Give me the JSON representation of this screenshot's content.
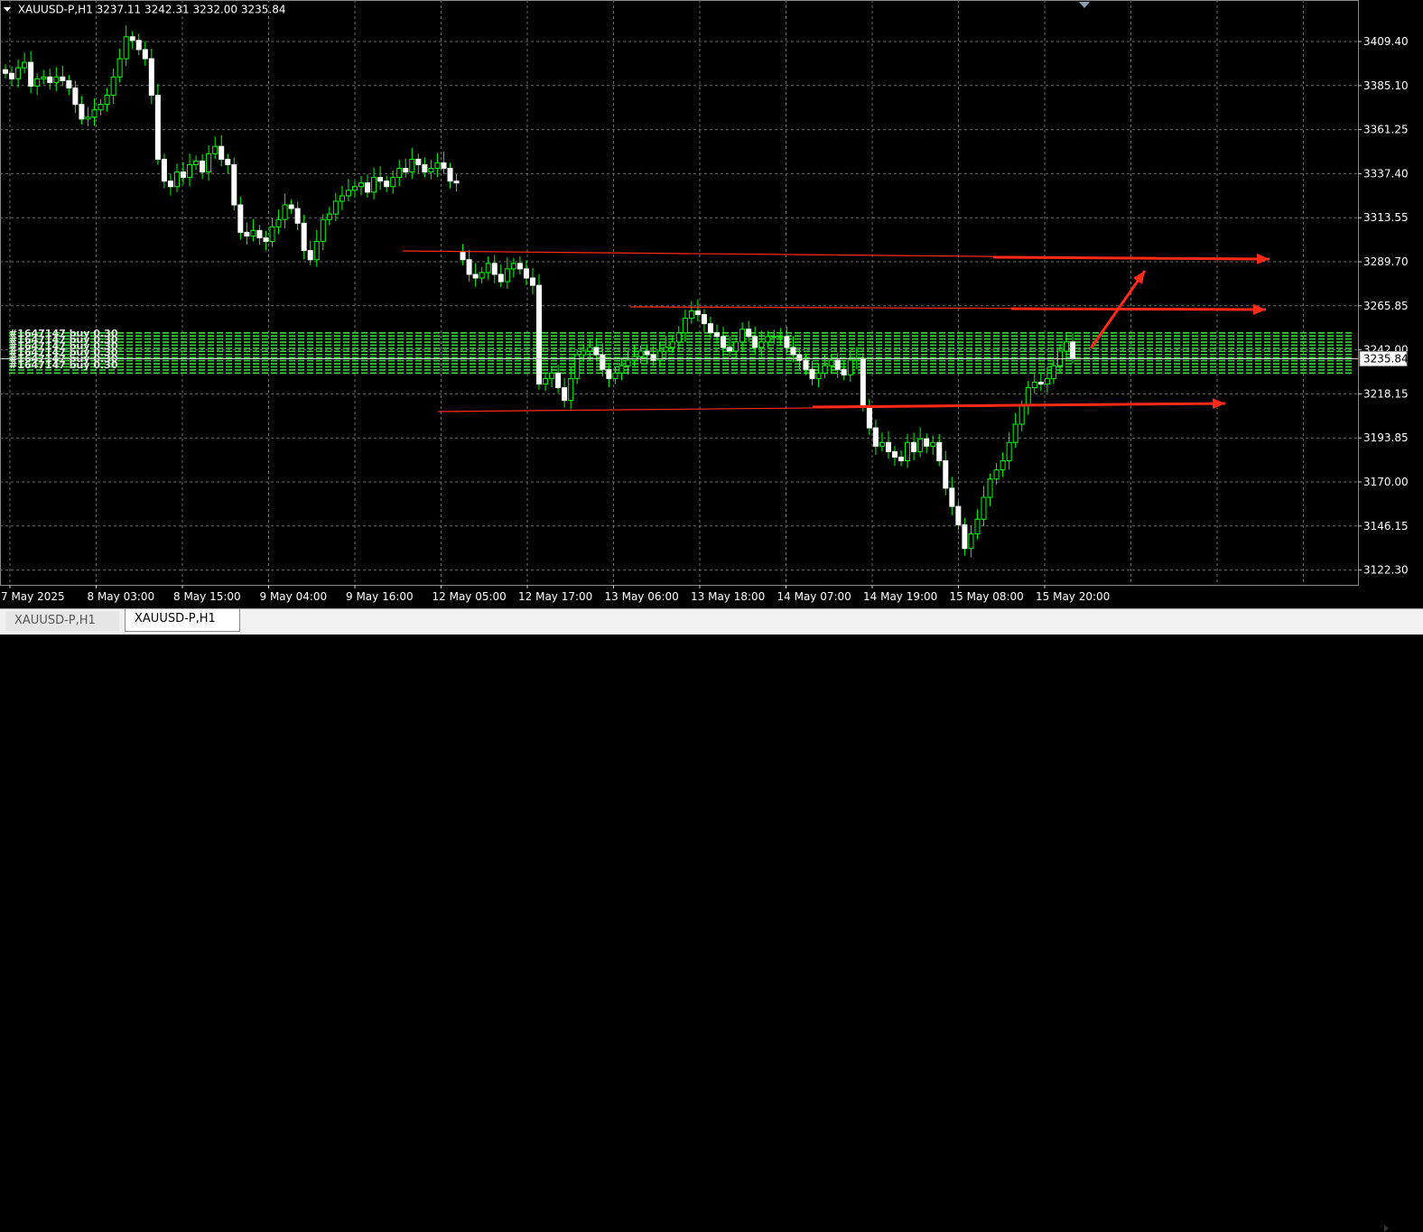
{
  "header": {
    "symbol": "XAUUSD-P,H1",
    "ohlc": "3237.11 3242.31 3232.00 3235.84"
  },
  "chart_data": {
    "type": "candlestick",
    "price_ticks": [
      "3409.40",
      "3385.10",
      "3361.25",
      "3337.40",
      "3313.55",
      "3289.70",
      "3265.85",
      "3242.00",
      "3218.15",
      "3193.85",
      "3170.00",
      "3146.15",
      "3122.30"
    ],
    "current_price": "3235.84",
    "time_ticks": [
      "7 May 2025",
      "8 May 03:00",
      "8 May 15:00",
      "9 May 04:00",
      "9 May 16:00",
      "12 May 05:00",
      "12 May 17:00",
      "13 May 06:00",
      "13 May 18:00",
      "14 May 07:00",
      "14 May 19:00",
      "15 May 08:00",
      "15 May 20:00"
    ],
    "candles": [
      3392,
      3389,
      3395,
      3398,
      3385,
      3389,
      3390,
      3387,
      3390,
      3388,
      3384,
      3375,
      3367,
      3368,
      3372,
      3375,
      3380,
      3390,
      3400,
      3412,
      3410,
      3405,
      3400,
      3380,
      3345,
      3333,
      3330,
      3338,
      3335,
      3342,
      3344,
      3338,
      3348,
      3352,
      3345,
      3342,
      3320,
      3305,
      3303,
      3306,
      3302,
      3300,
      3308,
      3312,
      3320,
      3318,
      3310,
      3295,
      3290,
      3300,
      3312,
      3315,
      3322,
      3325,
      3328,
      3330,
      3332,
      3327,
      3335,
      3333,
      3330,
      3335,
      3340,
      3338,
      3345,
      3342,
      3338,
      3340,
      3343,
      3340,
      3333,
      3332,
      3290,
      3282,
      3280,
      3283,
      3288,
      3282,
      3278,
      3285,
      3288,
      3285,
      3280,
      3276,
      3222,
      3225,
      3228,
      3220,
      3213,
      3225,
      3238,
      3240,
      3242,
      3238,
      3230,
      3225,
      3228,
      3232,
      3235,
      3237,
      3240,
      3238,
      3235,
      3240,
      3242,
      3245,
      3250,
      3258,
      3262,
      3260,
      3255,
      3250,
      3248,
      3242,
      3240,
      3245,
      3252,
      3248,
      3242,
      3245,
      3248,
      3248,
      3248,
      3242,
      3238,
      3235,
      3230,
      3225,
      3228,
      3232,
      3235,
      3230,
      3227,
      3235,
      3236,
      3210,
      3198,
      3188,
      3190,
      3185,
      3182,
      3180,
      3190,
      3185,
      3192,
      3188,
      3190,
      3180,
      3165,
      3155,
      3145,
      3132,
      3140,
      3148,
      3160,
      3170,
      3175,
      3180,
      3190,
      3200,
      3210,
      3220,
      3223,
      3222,
      3225,
      3232,
      3240,
      3245,
      3236
    ],
    "trend_lines": [
      {
        "from": [
          "12 May 05:00",
          3293
        ],
        "to": [
          "15 May 20:00+",
          3290
        ]
      },
      {
        "from": [
          "13 May 06:00",
          3264
        ],
        "to": [
          "15 May 20:00+",
          3262
        ]
      },
      {
        "from": [
          "12 May 05:00",
          3213
        ],
        "to": [
          "15 May 20:00+",
          3215
        ]
      },
      {
        "from": [
          "15 May 20:00",
          3242
        ],
        "to": [
          "15 May 20:00+",
          3285
        ]
      }
    ],
    "order_label_values": [
      "3235.84"
    ],
    "colors": {
      "background": "#000000",
      "grid": "#6b6b6b",
      "bull": "#000000",
      "bear": "#ffffff",
      "wick": "#00ff00",
      "orders": "#3fd63f",
      "trend": "#ff2a1a",
      "text": "#ffffff"
    }
  },
  "tabs": [
    {
      "label": "XAUUSD-P,H1",
      "active": false
    },
    {
      "label": "XAUUSD-P,H1",
      "active": true
    }
  ],
  "overlay_text": "#1647147 buy 0.30"
}
